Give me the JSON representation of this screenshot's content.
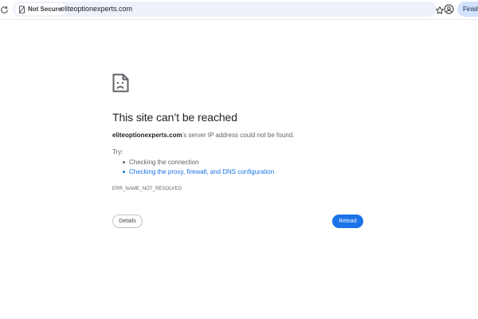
{
  "browser": {
    "security_chip": "Not Secure",
    "url": "eliteoptionexperts.com",
    "finish_label": "Finish",
    "icons": {
      "reload": "reload-icon",
      "security": "not-secure-icon",
      "bookmark": "star-icon",
      "profile": "profile-icon"
    }
  },
  "error_page": {
    "icon": "sad-page-icon",
    "title": "This site can’t be reached",
    "host": "eliteoptionexperts.com",
    "message_suffix": "’s server IP address could not be found.",
    "try_label": "Try:",
    "suggestions": [
      {
        "label": "Checking the connection"
      },
      {
        "label": "Checking the proxy, firewall, and DNS configuration"
      }
    ],
    "error_code": "ERR_NAME_NOT_RESOLVED",
    "details_label": "Details",
    "reload_label": "Reload"
  },
  "colors": {
    "accent": "#1a73e8",
    "omnibox_bg": "#edf2fa",
    "finish_bg": "#d3e3fd",
    "text_primary": "#202124",
    "text_secondary": "#5f6368"
  }
}
